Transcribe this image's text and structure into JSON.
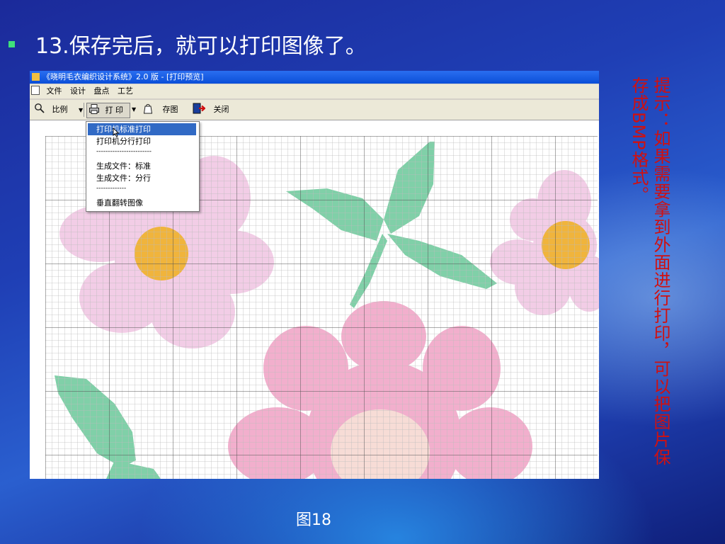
{
  "slide": {
    "title": "13.保存完后，就可以打印图像了。",
    "caption": "图18",
    "tip": "提示：如果需要拿到外面进行打印，可以把图片保存成BMP格式。"
  },
  "window": {
    "title": "《晓明毛衣编织设计系统》2.0 版 - [打印预览]",
    "menu": [
      "文件",
      "设计",
      "盘点",
      "工艺"
    ],
    "toolbar": {
      "scale": "比例",
      "print": "打 印",
      "save_image": "存图",
      "close": "关闭"
    },
    "print_menu": {
      "items": [
        "打印机标准打印",
        "打印机分行打印",
        "生成文件：标准",
        "生成文件：分行",
        "垂直翻转图像"
      ],
      "sep_long": "------------------------",
      "sep_short": "-------------"
    }
  },
  "colors": {
    "bullet": "#3fe07a",
    "tip_text": "#d01010",
    "petal_light": "#f2cde6",
    "petal_pink": "#f2afcd",
    "flower_center": "#f0b43c",
    "center_light": "#f7dcd6",
    "leaf": "#80d0a8",
    "grid_line": "#bcbcbc",
    "menu_highlight": "#316ac5"
  },
  "icons": {
    "scale": "magnifier-icon",
    "print": "printer-icon",
    "save_image": "bag-icon",
    "close": "exit-door-icon"
  }
}
